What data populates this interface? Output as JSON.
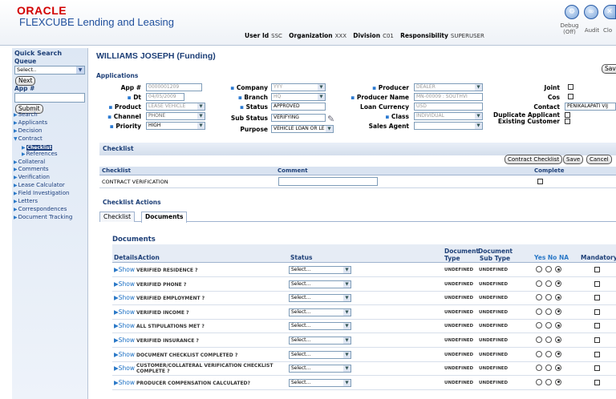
{
  "header": {
    "brand": "ORACLE",
    "app_title": "FLEXCUBE Lending and Leasing",
    "user_id_label": "User Id",
    "user_id": "SSC",
    "org_label": "Organization",
    "org": "XXX",
    "division_label": "Division",
    "division": "C01",
    "resp_label": "Responsibility",
    "resp": "SUPERUSER",
    "debug_label": "Debug",
    "debug_state": "(Off)",
    "audit_label": "Audit",
    "close_label": "Clo"
  },
  "sidebar": {
    "quick_search": "Quick Search",
    "queue_label": "Queue",
    "queue_value": "Select..",
    "next": "Next",
    "app_label": "App #",
    "submit": "Submit",
    "items": [
      {
        "label": "Search",
        "sub": false,
        "active": false
      },
      {
        "label": "Applicants",
        "sub": false,
        "active": false
      },
      {
        "label": "Decision",
        "sub": false,
        "active": false
      },
      {
        "label": "Contract",
        "sub": false,
        "active": false,
        "open": true
      },
      {
        "label": "Checklist",
        "sub": true,
        "active": true
      },
      {
        "label": "References",
        "sub": true,
        "active": false
      },
      {
        "label": "Collateral",
        "sub": false,
        "active": false
      },
      {
        "label": "Comments",
        "sub": false,
        "active": false
      },
      {
        "label": "Verification",
        "sub": false,
        "active": false
      },
      {
        "label": "Lease Calculator",
        "sub": false,
        "active": false
      },
      {
        "label": "Field Investigation",
        "sub": false,
        "active": false
      },
      {
        "label": "Letters",
        "sub": false,
        "active": false
      },
      {
        "label": "Correspondences",
        "sub": false,
        "active": false
      },
      {
        "label": "Document Tracking",
        "sub": false,
        "active": false
      }
    ]
  },
  "page": {
    "title": "WILLIAMS JOSEPH (Funding)",
    "save": "Save",
    "section_applications": "Applications"
  },
  "app": {
    "app_no_label": "App #",
    "app_no": "0000001209",
    "dt_label": "Dt",
    "dt": "04/05/2009",
    "product_label": "Product",
    "product": "LEASE VEHICLE",
    "channel_label": "Channel",
    "channel": "PHONE",
    "priority_label": "Priority",
    "priority": "HIGH",
    "company_label": "Company",
    "company": "YYY",
    "branch_label": "Branch",
    "branch": "HQ",
    "status_label": "Status",
    "status": "APPROVED",
    "substatus_label": "Sub Status",
    "substatus": "VERIFYING",
    "purpose_label": "Purpose",
    "purpose": "VEHICLE LOAN OR LE",
    "producer_label": "Producer",
    "producer": "DEALER",
    "producer_name_label": "Producer Name",
    "producer_name": "MN-00009 : SOUTHVI",
    "loan_currency_label": "Loan Currency",
    "loan_currency": "USD",
    "class_label": "Class",
    "class": "INDIVIDUAL",
    "sales_agent_label": "Sales Agent",
    "sales_agent": "",
    "joint_label": "Joint",
    "cos_label": "Cos",
    "contact_label": "Contact",
    "contact": "PENIKALAPATI VIJ",
    "dup_label": "Duplicate Applicant",
    "existing_label": "Existing Customer"
  },
  "checklist": {
    "section": "Checklist",
    "btn_contract": "Contract Checklist",
    "btn_save": "Save",
    "btn_cancel": "Cancel",
    "col_checklist": "Checklist",
    "col_comment": "Comment",
    "col_complete": "Complete",
    "row_name": "CONTRACT VERIFICATION",
    "row_comment": ""
  },
  "actions": {
    "section": "Checklist Actions",
    "tab_checklist": "Checklist",
    "tab_documents": "Documents"
  },
  "documents": {
    "section": "Documents",
    "h_details": "Details",
    "h_action": "Action",
    "h_status": "Status",
    "h_doc_type": "Document Type",
    "h_doc_sub": "Document Sub Type",
    "h_ynna": "Yes No NA",
    "h_mand": "Mandatory",
    "show": "Show",
    "status_placeholder": "Select...",
    "rows": [
      {
        "action": "VERIFIED RESIDENCE ?",
        "type": "UNDEFINED",
        "subtype": "UNDEFINED",
        "selected": "na"
      },
      {
        "action": "VERIFIED PHONE ?",
        "type": "UNDEFINED",
        "subtype": "UNDEFINED",
        "selected": "na"
      },
      {
        "action": "VERIFIED EMPLOYMENT ?",
        "type": "UNDEFINED",
        "subtype": "UNDEFINED",
        "selected": "na"
      },
      {
        "action": "VERIFIED INCOME ?",
        "type": "UNDEFINED",
        "subtype": "UNDEFINED",
        "selected": "na"
      },
      {
        "action": "ALL STIPULATIONS MET ?",
        "type": "UNDEFINED",
        "subtype": "UNDEFINED",
        "selected": "na"
      },
      {
        "action": "VERIFIED INSURANCE ?",
        "type": "UNDEFINED",
        "subtype": "UNDEFINED",
        "selected": "na"
      },
      {
        "action": "DOCUMENT CHECKLIST COMPLETED ?",
        "type": "UNDEFINED",
        "subtype": "UNDEFINED",
        "selected": "na"
      },
      {
        "action": "CUSTOMER/COLLATERAL VERIFICATION CHECKLIST COMPLETE ?",
        "type": "UNDEFINED",
        "subtype": "UNDEFINED",
        "selected": "na"
      },
      {
        "action": "PRODUCER COMPENSATION CALCULATED?",
        "type": "UNDEFINED",
        "subtype": "UNDEFINED",
        "selected": "na"
      }
    ]
  }
}
